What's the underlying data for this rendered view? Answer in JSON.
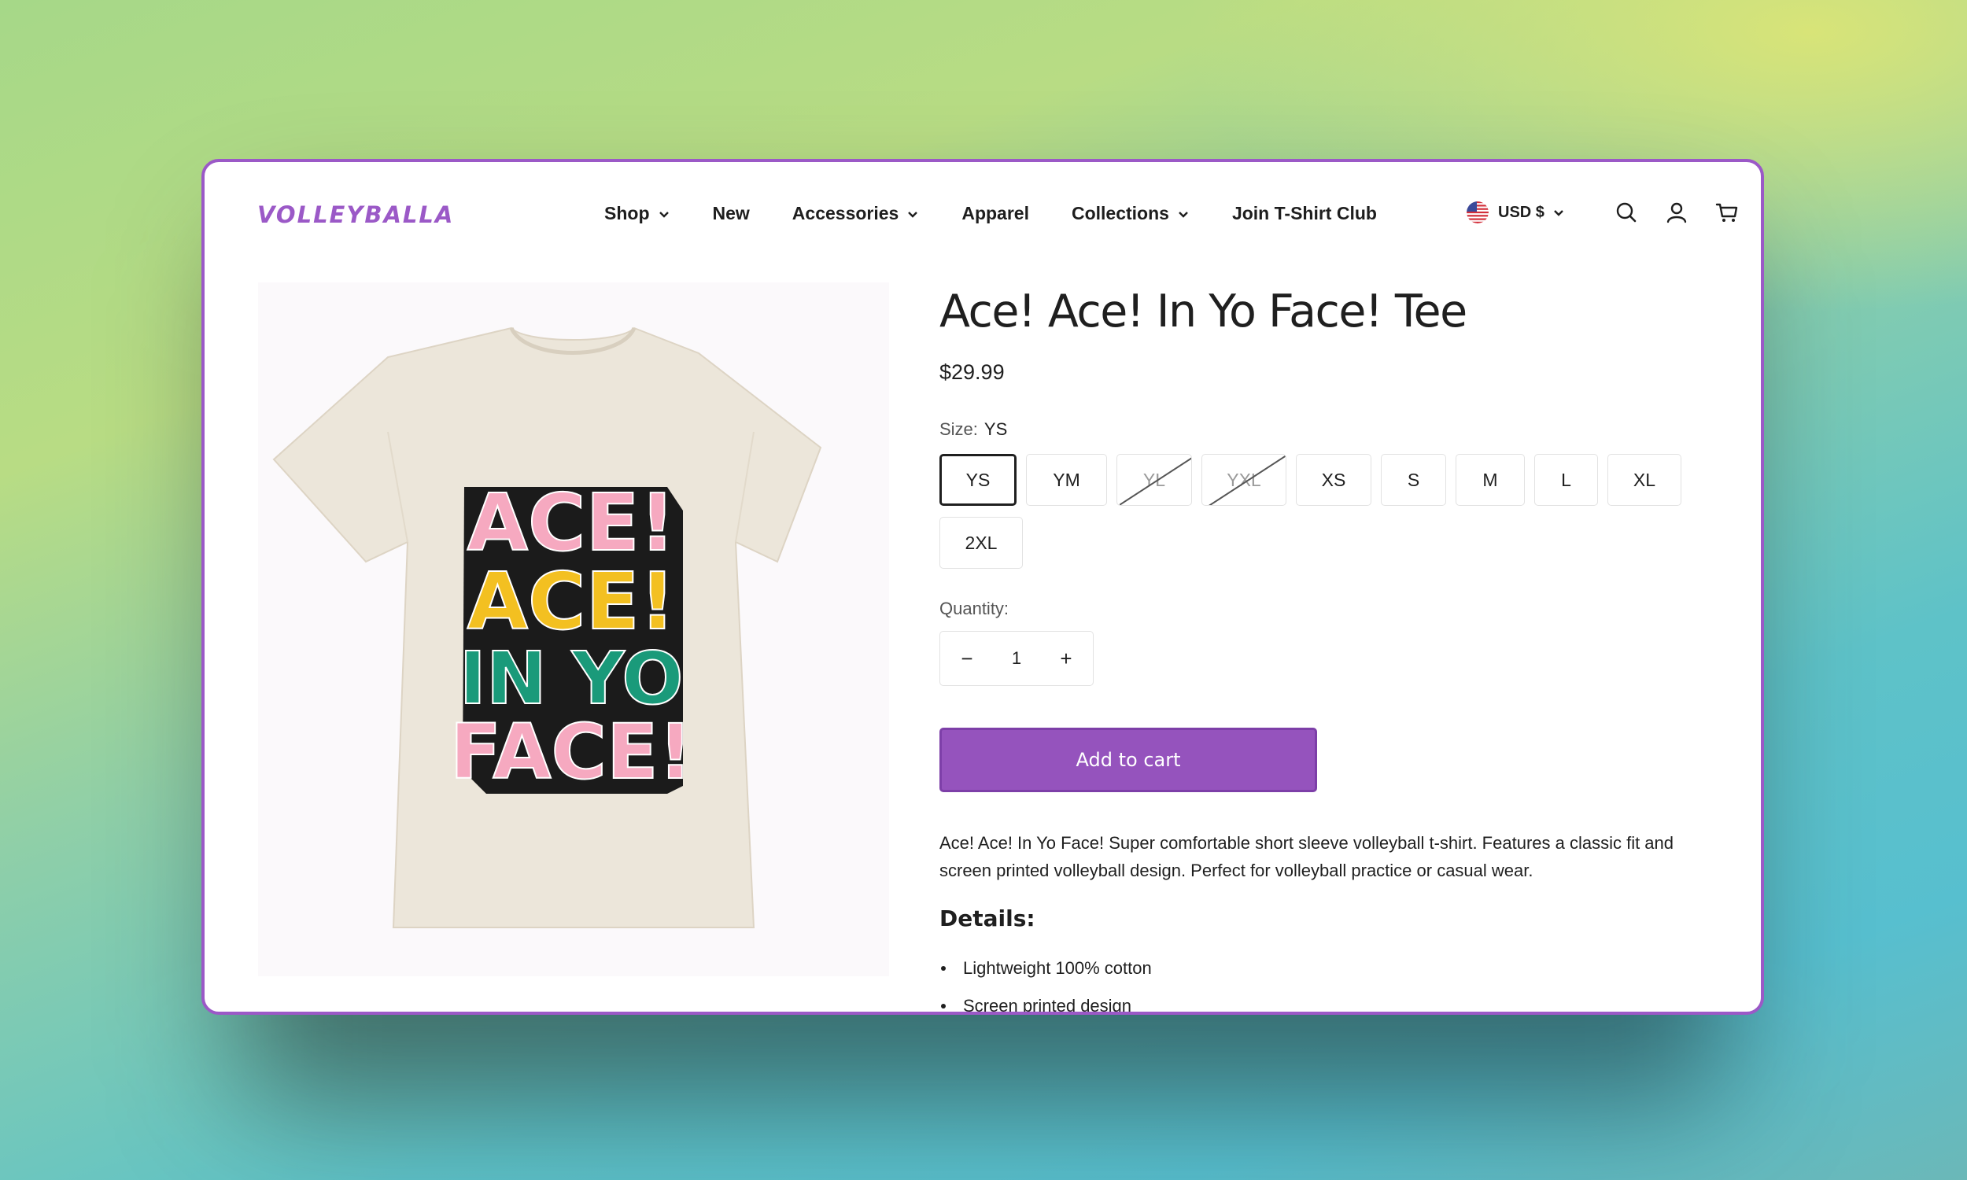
{
  "header": {
    "logo": "VOLLEYBALLA",
    "nav": [
      {
        "label": "Shop",
        "dropdown": true
      },
      {
        "label": "New",
        "dropdown": false
      },
      {
        "label": "Accessories",
        "dropdown": true
      },
      {
        "label": "Apparel",
        "dropdown": false
      },
      {
        "label": "Collections",
        "dropdown": true
      },
      {
        "label": "Join T-Shirt Club",
        "dropdown": false
      }
    ],
    "currency": "USD $",
    "icons": [
      "us-flag-icon",
      "search-icon",
      "account-icon",
      "cart-icon"
    ]
  },
  "product": {
    "title": "Ace! Ace! In Yo Face! Tee",
    "price": "$29.99",
    "image_text": [
      "ACE!",
      "ACE!",
      "IN YO",
      "FACE!"
    ],
    "size_label": "Size:",
    "size_selected": "YS",
    "sizes": [
      {
        "label": "YS",
        "state": "selected"
      },
      {
        "label": "YM",
        "state": "available"
      },
      {
        "label": "YL",
        "state": "unavailable"
      },
      {
        "label": "YXL",
        "state": "unavailable"
      },
      {
        "label": "XS",
        "state": "available"
      },
      {
        "label": "S",
        "state": "available"
      },
      {
        "label": "M",
        "state": "available"
      },
      {
        "label": "L",
        "state": "available"
      },
      {
        "label": "XL",
        "state": "available"
      },
      {
        "label": "2XL",
        "state": "available"
      }
    ],
    "quantity_label": "Quantity:",
    "quantity": "1",
    "qty_minus": "−",
    "qty_plus": "+",
    "add_to_cart": "Add to cart",
    "description": "Ace! Ace! In Yo Face! Super comfortable short sleeve volleyball t-shirt. Features a classic fit and screen printed volleyball design. Perfect for volleyball practice or casual wear.",
    "details_heading": "Details:",
    "details": [
      "Lightweight 100% cotton",
      "Screen printed design"
    ]
  },
  "colors": {
    "brand": "#9b59c7",
    "button": "#9553bd",
    "shirt": "#ece6da",
    "text": "#1f1f1f"
  }
}
